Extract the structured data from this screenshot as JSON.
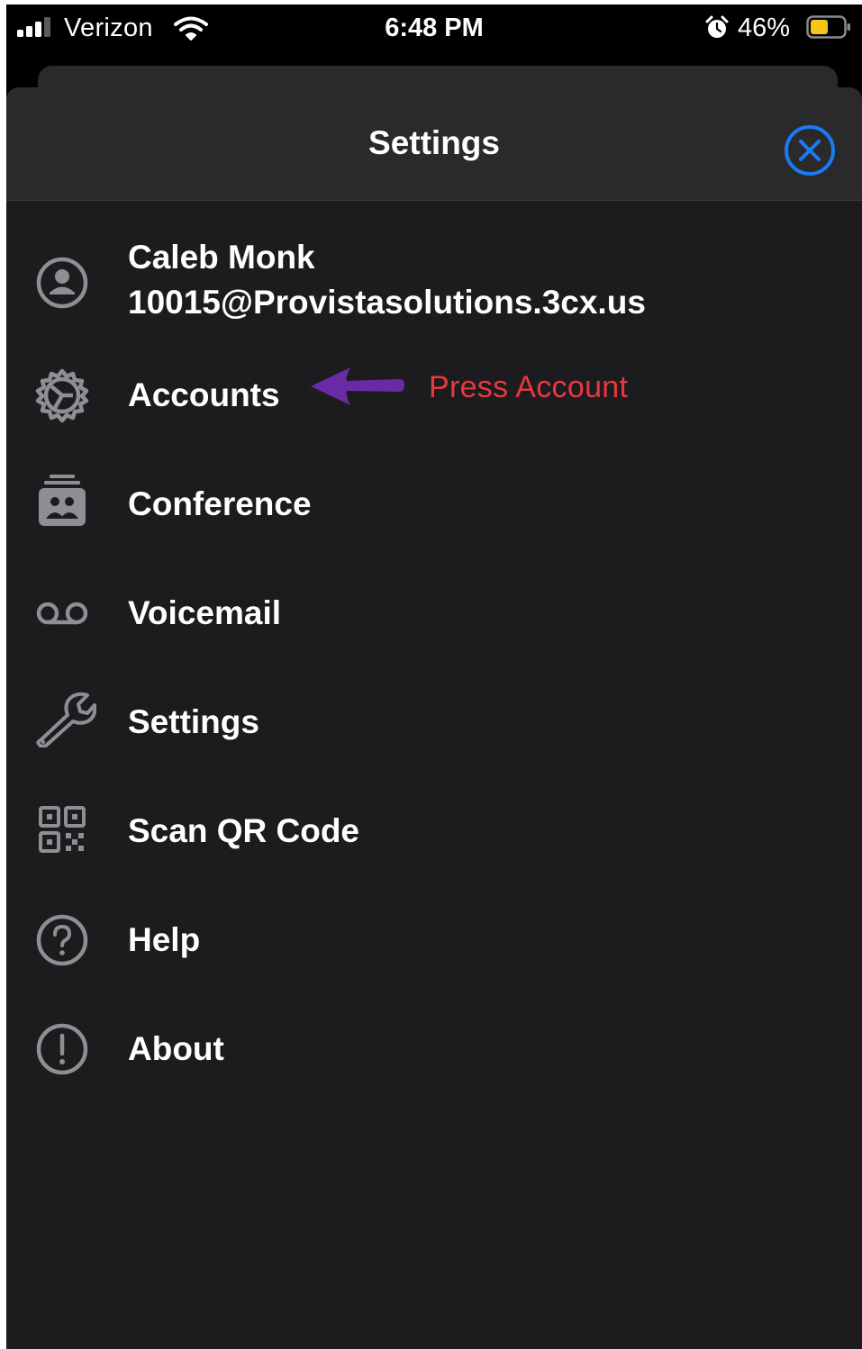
{
  "status_bar": {
    "carrier": "Verizon",
    "time": "6:48 PM",
    "battery_percent": "46%",
    "icons": [
      "signal-icon",
      "wifi-icon",
      "alarm-icon",
      "battery-icon"
    ]
  },
  "header": {
    "title": "Settings",
    "close_icon": "close-icon"
  },
  "profile": {
    "name": "Caleb Monk",
    "email": "10015@Provistasolutions.3cx.us",
    "icon": "user-circle-icon"
  },
  "menu": {
    "items": [
      {
        "label": "Accounts",
        "icon": "gear-icon"
      },
      {
        "label": "Conference",
        "icon": "conference-icon"
      },
      {
        "label": "Voicemail",
        "icon": "voicemail-icon"
      },
      {
        "label": "Settings",
        "icon": "wrench-icon"
      },
      {
        "label": "Scan QR Code",
        "icon": "qr-code-icon"
      },
      {
        "label": "Help",
        "icon": "help-icon"
      },
      {
        "label": "About",
        "icon": "info-icon"
      }
    ]
  },
  "annotation": {
    "text": "Press Account",
    "arrow_icon": "arrow-left-icon"
  },
  "colors": {
    "background": "#1c1c1e",
    "header": "#2a2a2c",
    "text": "#ffffff",
    "icon": "#8e8e93",
    "accent": "#1a7bf2",
    "annotation_text": "#e8383d",
    "annotation_arrow": "#6a2aa6",
    "battery": "#f5c518"
  }
}
